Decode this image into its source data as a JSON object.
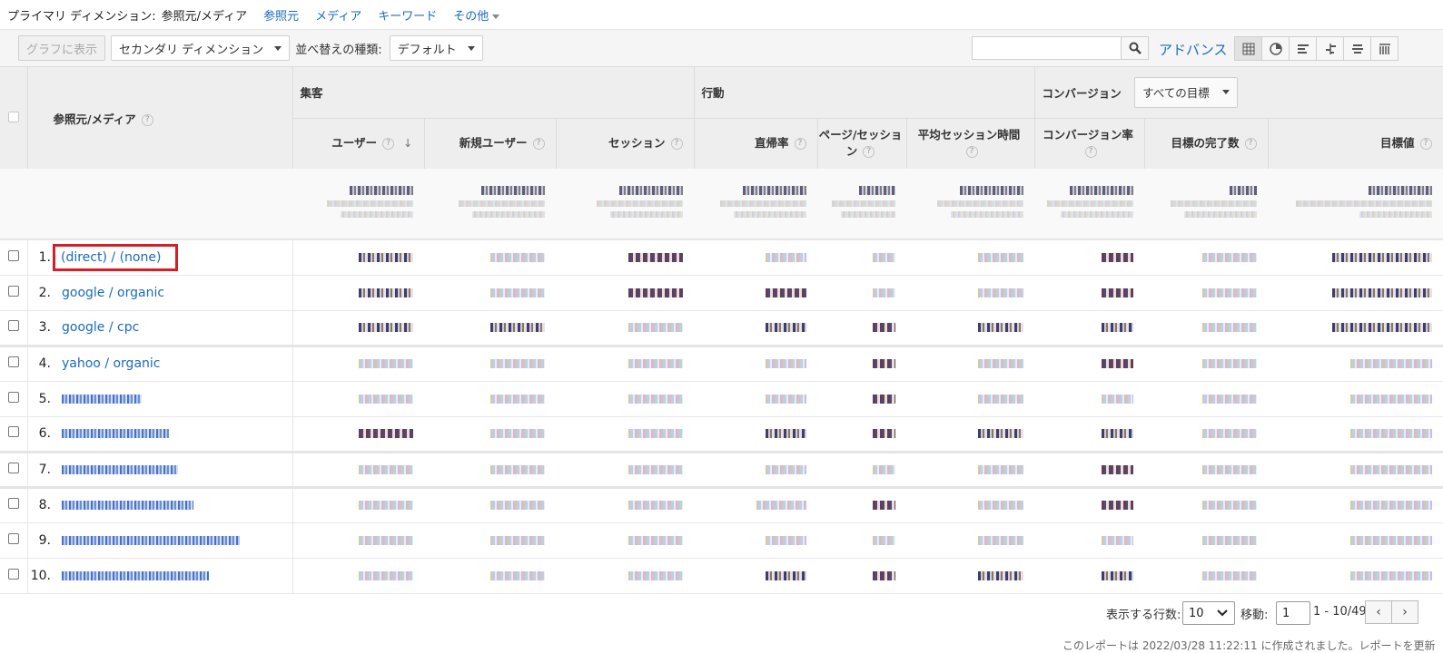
{
  "primary_dimension": {
    "label": "プライマリ ディメンション:",
    "selected": "参照元/メディア",
    "options": [
      "参照元",
      "メディア",
      "キーワード",
      "その他"
    ]
  },
  "toolbar": {
    "graph_button": "グラフに表示",
    "secondary_dimension": "セカンダリ ディメンション",
    "sort_label": "並べ替えの種類:",
    "sort_value": "デフォルト",
    "search_placeholder": "",
    "advance_link": "アドバンス",
    "views": [
      "table-icon",
      "pie-icon",
      "bar-icon",
      "comparison-icon",
      "term-cloud-icon",
      "pivot-icon"
    ]
  },
  "table": {
    "dimension_header": "参照元/メディア",
    "groups": {
      "acquisition": "集客",
      "behavior": "行動",
      "conversions": "コンバージョン"
    },
    "goal_select": "すべての目標",
    "metrics": [
      "ユーザー",
      "新規ユーザー",
      "セッション",
      "直帰率",
      "ページ/セッション",
      "平均セッション時間",
      "コンバージョン率",
      "目標の完了数",
      "目標値"
    ],
    "rows": [
      {
        "index": "1.",
        "name": "(direct) / (none)"
      },
      {
        "index": "2.",
        "name": "google / organic"
      },
      {
        "index": "3.",
        "name": "google / cpc"
      },
      {
        "index": "4.",
        "name": "yahoo / organic"
      },
      {
        "index": "5.",
        "name": ""
      },
      {
        "index": "6.",
        "name": ""
      },
      {
        "index": "7.",
        "name": ""
      },
      {
        "index": "8.",
        "name": ""
      },
      {
        "index": "9.",
        "name": ""
      },
      {
        "index": "10.",
        "name": ""
      }
    ]
  },
  "pagination": {
    "rows_label": "表示する行数:",
    "rows_value": "10",
    "goto_label": "移動:",
    "goto_value": "1",
    "range": "1 - 10/49"
  },
  "footnote": "このレポートは 2022/03/28 11:22:11 に作成されました。レポートを更新",
  "colors": {
    "link": "#1a6bbd",
    "highlight": "#d32027"
  }
}
